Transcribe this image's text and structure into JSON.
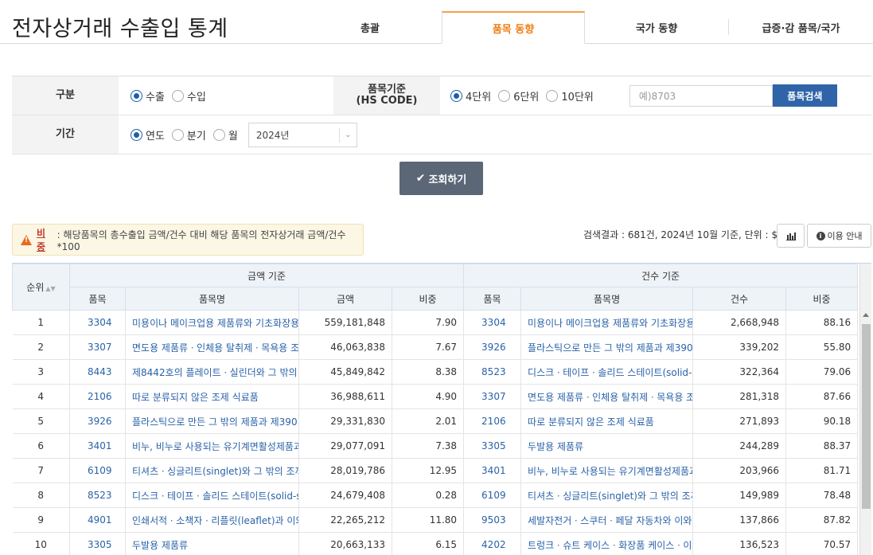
{
  "page_title": "전자상거래 수출입 통계",
  "tabs": [
    {
      "label": "총괄"
    },
    {
      "label": "품목 동향"
    },
    {
      "label": "국가 동향"
    },
    {
      "label": "급증·감 품목/국가"
    }
  ],
  "filter": {
    "type_label": "구분",
    "type_options": [
      {
        "label": "수출",
        "selected": true
      },
      {
        "label": "수입",
        "selected": false
      }
    ],
    "hs_label_line1": "품목기준",
    "hs_label_line2": "(HS CODE)",
    "hs_options": [
      {
        "label": "4단위",
        "selected": true
      },
      {
        "label": "6단위",
        "selected": false
      },
      {
        "label": "10단위",
        "selected": false
      }
    ],
    "search_placeholder": "예)8703",
    "search_button": "품목검색",
    "period_label": "기간",
    "period_options": [
      {
        "label": "연도",
        "selected": true
      },
      {
        "label": "분기",
        "selected": false
      },
      {
        "label": "월",
        "selected": false
      }
    ],
    "period_select_value": "2024년"
  },
  "query_button": "조회하기",
  "notice": {
    "bold": "비중",
    "text": ": 해당품목의 총수출입 금액/건수 대비 해당 품목의 전자상거래 금액/건수*100"
  },
  "result_info": "검색결과 : 681건, 2024년 10월 기준, 단위 : $",
  "guide_button": "이용 안내",
  "table": {
    "rank_header": "순위",
    "amount_group": "금액 기준",
    "count_group": "건수 기준",
    "sub_headers": {
      "item": "품목",
      "item_name": "품목명",
      "amount": "금액",
      "ratio": "비중",
      "count": "건수"
    },
    "rows": [
      {
        "rank": "1",
        "a_code": "3304",
        "a_name": "미용이나 메이크업용 제품류와 기초화장용",
        "a_amount": "559,181,848",
        "a_ratio": "7.90",
        "c_code": "3304",
        "c_name": "미용이나 메이크업용 제품류와 기초화장용",
        "c_count": "2,668,948",
        "c_ratio": "88.16"
      },
      {
        "rank": "2",
        "a_code": "3307",
        "a_name": "면도용 제품류ㆍ인체용 탈취제ㆍ목욕용 조제",
        "a_amount": "46,063,838",
        "a_ratio": "7.67",
        "c_code": "3926",
        "c_name": "플라스틱으로 만든 그 밖의 제품과 제3901",
        "c_count": "339,202",
        "c_ratio": "55.80"
      },
      {
        "rank": "3",
        "a_code": "8443",
        "a_name": "제8442호의 플레이트ㆍ실린더와 그 밖의 인",
        "a_amount": "45,849,842",
        "a_ratio": "8.38",
        "c_code": "8523",
        "c_name": "디스크ㆍ테이프ㆍ솔리드 스테이트(solid-st",
        "c_count": "322,364",
        "c_ratio": "79.06"
      },
      {
        "rank": "4",
        "a_code": "2106",
        "a_name": "따로 분류되지 않은 조제 식료품",
        "a_amount": "36,988,611",
        "a_ratio": "4.90",
        "c_code": "3307",
        "c_name": "면도용 제품류ㆍ인체용 탈취제ㆍ목욕용 조제",
        "c_count": "281,318",
        "c_ratio": "87.66"
      },
      {
        "rank": "5",
        "a_code": "3926",
        "a_name": "플라스틱으로 만든 그 밖의 제품과 제3901",
        "a_amount": "29,331,830",
        "a_ratio": "2.01",
        "c_code": "2106",
        "c_name": "따로 분류되지 않은 조제 식료품",
        "c_count": "271,893",
        "c_ratio": "90.18"
      },
      {
        "rank": "6",
        "a_code": "3401",
        "a_name": "비누, 비누로 사용되는 유기계면활성제품과",
        "a_amount": "29,077,091",
        "a_ratio": "7.38",
        "c_code": "3305",
        "c_name": "두발용 제품류",
        "c_count": "244,289",
        "c_ratio": "88.37"
      },
      {
        "rank": "7",
        "a_code": "6109",
        "a_name": "티셔츠ㆍ싱글리트(singlet)와 그 밖의 조끼",
        "a_amount": "28,019,786",
        "a_ratio": "12.95",
        "c_code": "3401",
        "c_name": "비누, 비누로 사용되는 유기계면활성제품과",
        "c_count": "203,966",
        "c_ratio": "81.71"
      },
      {
        "rank": "8",
        "a_code": "8523",
        "a_name": "디스크ㆍ테이프ㆍ솔리드 스테이트(solid-st",
        "a_amount": "24,679,408",
        "a_ratio": "0.28",
        "c_code": "6109",
        "c_name": "티셔츠ㆍ싱글리트(singlet)와 그 밖의 조끼",
        "c_count": "149,989",
        "c_ratio": "78.48"
      },
      {
        "rank": "9",
        "a_code": "4901",
        "a_name": "인쇄서적ㆍ소책자ㆍ리플릿(leaflet)과 이와",
        "a_amount": "22,265,212",
        "a_ratio": "11.80",
        "c_code": "9503",
        "c_name": "세발자전거ㆍ스쿠터ㆍ페달 자동차와 이와 유",
        "c_count": "137,866",
        "c_ratio": "87.82"
      },
      {
        "rank": "10",
        "a_code": "3305",
        "a_name": "두발용 제품류",
        "a_amount": "20,663,133",
        "a_ratio": "6.15",
        "c_code": "4202",
        "c_name": "트렁크ㆍ슈트 케이스ㆍ화장품 케이스ㆍ이그",
        "c_count": "136,523",
        "c_ratio": "70.57"
      }
    ]
  }
}
